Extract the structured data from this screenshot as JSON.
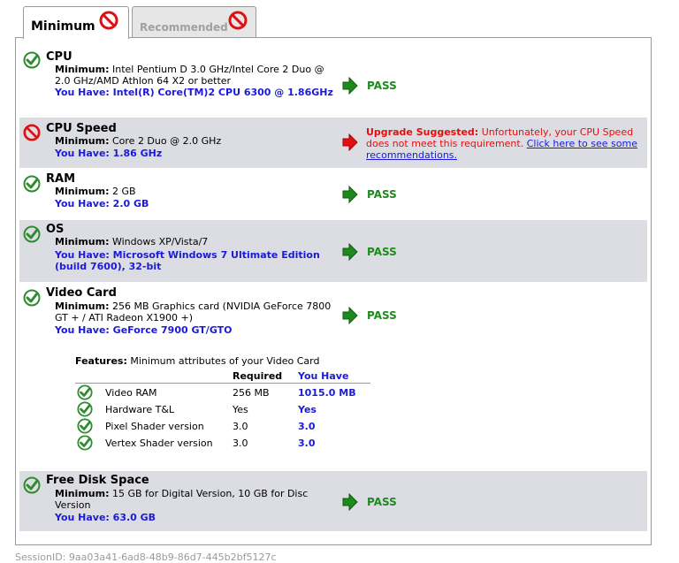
{
  "tabs": {
    "minimum": "Minimum",
    "recommended": "Recommended"
  },
  "rows": {
    "cpu": {
      "title": "CPU",
      "min_label": "Minimum:",
      "min_value": "Intel Pentium D 3.0 GHz/Intel Core 2 Duo @ 2.0 GHz/AMD Athlon 64 X2 or better",
      "have": "You Have: Intel(R) Core(TM)2 CPU 6300 @ 1.86GHz",
      "result": "PASS"
    },
    "cpu_speed": {
      "title": "CPU Speed",
      "min_label": "Minimum:",
      "min_value": "Core 2 Duo @ 2.0 GHz",
      "have": "You Have: 1.86 GHz",
      "upgrade_label": "Upgrade Suggested:",
      "upgrade_text": "Unfortunately, your CPU Speed does not meet this requirement.",
      "upgrade_link": "Click here to see some recommendations."
    },
    "ram": {
      "title": "RAM",
      "min_label": "Minimum:",
      "min_value": "2 GB",
      "have": "You Have: 2.0 GB",
      "result": "PASS"
    },
    "os": {
      "title": "OS",
      "min_label": "Minimum:",
      "min_value": "Windows XP/Vista/7",
      "have": "You Have: Microsoft Windows 7 Ultimate Edition (build 7600), 32-bit",
      "result": "PASS"
    },
    "video": {
      "title": "Video Card",
      "min_label": "Minimum:",
      "min_value": "256 MB Graphics card (NVIDIA GeForce 7800 GT + / ATI Radeon X1900 +)",
      "have": "You Have: GeForce 7900 GT/GTO",
      "result": "PASS"
    },
    "disk": {
      "title": "Free Disk Space",
      "min_label": "Minimum:",
      "min_value": "15 GB for Digital Version, 10 GB for Disc Version",
      "have": "You Have: 63.0 GB",
      "result": "PASS"
    }
  },
  "features": {
    "label": "Features:",
    "text": "Minimum attributes of your Video Card",
    "col_required": "Required",
    "col_have": "You Have",
    "items": [
      {
        "name": "Video RAM",
        "required": "256 MB",
        "have": "1015.0 MB"
      },
      {
        "name": "Hardware T&L",
        "required": "Yes",
        "have": "Yes"
      },
      {
        "name": "Pixel Shader version",
        "required": "3.0",
        "have": "3.0"
      },
      {
        "name": "Vertex Shader version",
        "required": "3.0",
        "have": "3.0"
      }
    ]
  },
  "session": "SessionID: 9aa03a41-6ad8-48b9-86d7-445b2bf5127c",
  "colors": {
    "pass": "#1e8a1e",
    "fail": "#e01010",
    "have": "#1a1ad8",
    "shaded_row": "#dcdde3"
  },
  "icons": {
    "pass": "check-circle-icon",
    "fail": "no-entry-icon",
    "pass_arrow": "green-arrow-icon",
    "fail_arrow": "red-arrow-icon"
  }
}
